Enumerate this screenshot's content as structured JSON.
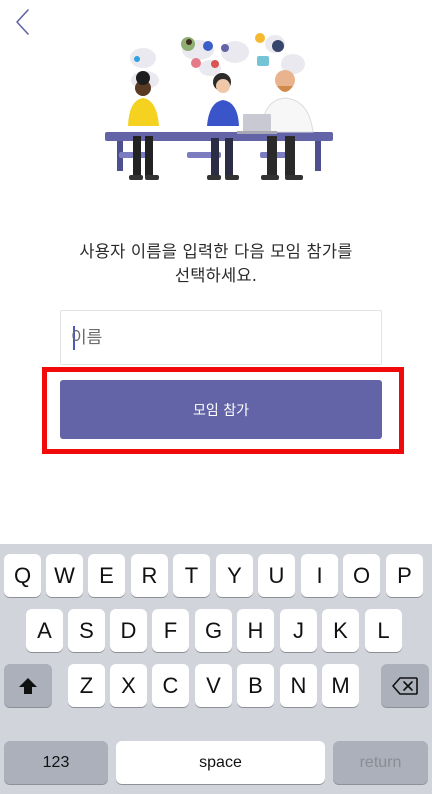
{
  "nav": {
    "back_icon": "chevron-left-icon"
  },
  "prompt": {
    "line1": "사용자 이름을 입력한 다음 모임 참가를",
    "line2": "선택하세요."
  },
  "name_field": {
    "placeholder": "이름",
    "value": ""
  },
  "join_button": {
    "label": "모임 참가"
  },
  "keyboard": {
    "row1": [
      "Q",
      "W",
      "E",
      "R",
      "T",
      "Y",
      "U",
      "I",
      "O",
      "P"
    ],
    "row2": [
      "A",
      "S",
      "D",
      "F",
      "G",
      "H",
      "J",
      "K",
      "L"
    ],
    "row3": [
      "Z",
      "X",
      "C",
      "V",
      "B",
      "N",
      "M"
    ],
    "shift_icon": "shift-arrow-icon",
    "delete_icon": "backspace-icon",
    "numbers_label": "123",
    "space_label": "space",
    "return_label": "return"
  },
  "colors": {
    "accent": "#6264a7",
    "highlight": "#f00a0a",
    "keyboard_bg": "#d1d4db"
  }
}
